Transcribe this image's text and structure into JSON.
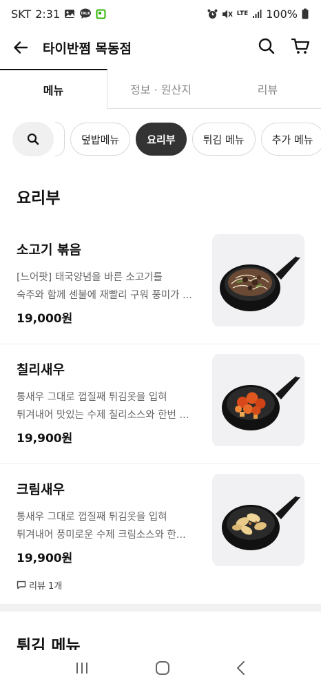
{
  "status_bar": {
    "carrier": "SKT",
    "time": "2:31",
    "network": "LTE",
    "battery": "100%"
  },
  "header": {
    "title": "타이반쩜 목동점"
  },
  "tabs": [
    {
      "label": "메뉴",
      "active": true
    },
    {
      "label": "정보 · 원산지",
      "active": false
    },
    {
      "label": "리뷰",
      "active": false
    }
  ],
  "categories": [
    {
      "label": "덮밥메뉴",
      "active": false
    },
    {
      "label": "요리부",
      "active": true
    },
    {
      "label": "튀김 메뉴",
      "active": false
    },
    {
      "label": "추가 메뉴",
      "active": false
    }
  ],
  "section": {
    "title": "요리부"
  },
  "menu_items": [
    {
      "name": "소고기 볶음",
      "desc_line1": "[느어팟] 태국양념을 바른 소고기를",
      "desc_line2": "숙주와 함께 센불에 재빨리 구워 풍미가 ...",
      "price": "19,000원",
      "review": ""
    },
    {
      "name": "칠리새우",
      "desc_line1": "통새우 그대로 껍질째 튀김옷을 입혀",
      "desc_line2": "튀겨내어 맛있는 수제 칠리소스와 한번 ...",
      "price": "19,900원",
      "review": ""
    },
    {
      "name": "크림새우",
      "desc_line1": "통새우 그대로 껍질째 튀김옷을 입혀",
      "desc_line2": "튀겨내어 풍미로운 수제 크림소스와 한...",
      "price": "19,900원",
      "review": "리뷰 1개"
    }
  ],
  "next_section": {
    "title": "튀김 메뉴"
  },
  "colors": {
    "active_chip": "#333333",
    "divider": "#f2f2f2",
    "muted_text": "#666666"
  }
}
